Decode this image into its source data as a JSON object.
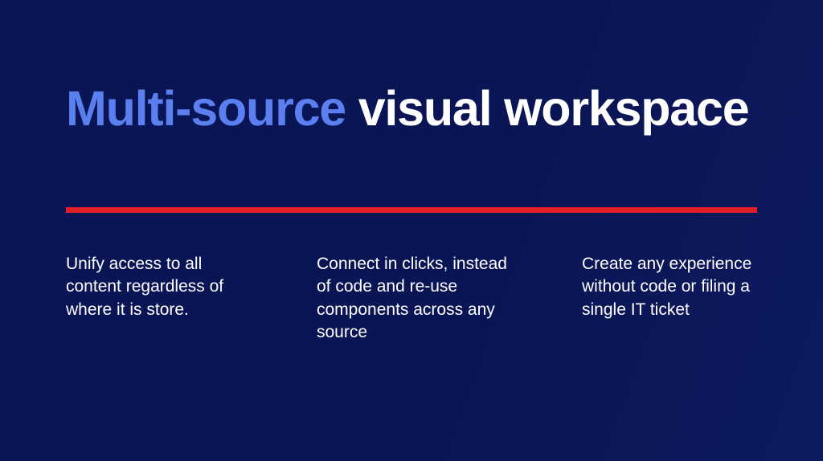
{
  "headline": {
    "accent": "Multi-source",
    "rest": " visual workspace"
  },
  "columns": [
    {
      "text": "Unify access to all content regardless of where it is store."
    },
    {
      "text": "Connect in clicks, instead of code and re-use components across any source"
    },
    {
      "text": "Create any experience without code or filing a single IT ticket"
    }
  ]
}
